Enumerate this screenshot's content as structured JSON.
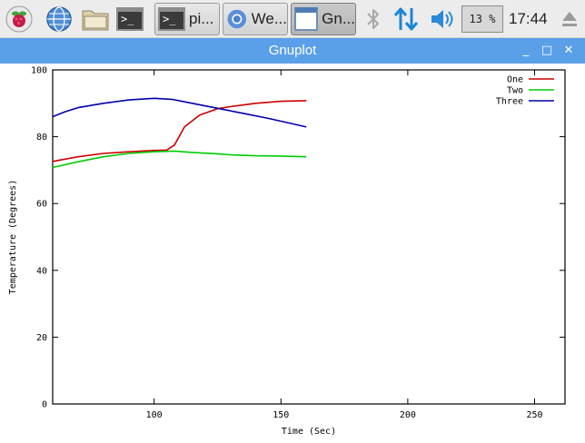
{
  "taskbar": {
    "launchers": [
      {
        "icon": "raspberry-menu-icon"
      },
      {
        "icon": "web-browser-icon"
      },
      {
        "icon": "file-manager-icon"
      },
      {
        "icon": "terminal-icon"
      }
    ],
    "tasks": [
      {
        "label": "pi...",
        "icon": "terminal-icon",
        "active": false
      },
      {
        "label": "We...",
        "icon": "chromium-icon",
        "active": false
      },
      {
        "label": "Gn...",
        "icon": "window-icon",
        "active": true
      }
    ],
    "tray": {
      "bluetooth_icon": "bluetooth-icon",
      "network_icon": "network-updown-icon",
      "volume_icon": "volume-icon",
      "cpu_usage": "13 %",
      "eject_icon": "eject-icon",
      "clock": "17:44"
    }
  },
  "window": {
    "title": "Gnuplot",
    "minimize": "_",
    "maximize": "□",
    "close": "✕"
  },
  "chart_data": {
    "type": "line",
    "title": "",
    "xlabel": "Time (Sec)",
    "ylabel": "Temperature (Degrees)",
    "xlim": [
      60,
      262
    ],
    "ylim": [
      0,
      100
    ],
    "xticks": [
      100,
      150,
      200,
      250
    ],
    "yticks": [
      0,
      20,
      40,
      60,
      80,
      100
    ],
    "grid": false,
    "legend": "top-right",
    "series": [
      {
        "name": "One",
        "color": "#cc0000",
        "x": [
          60,
          70,
          80,
          90,
          100,
          105,
          108,
          112,
          118,
          125,
          130,
          140,
          150,
          160
        ],
        "y": [
          72.6,
          74,
          75,
          75.5,
          75.9,
          76,
          77.5,
          83,
          86.5,
          88.4,
          89,
          90,
          90.6,
          90.8
        ]
      },
      {
        "name": "Two",
        "color": "#00cc00",
        "x": [
          60,
          70,
          80,
          90,
          100,
          108,
          115,
          125,
          130,
          140,
          150,
          160
        ],
        "y": [
          70.8,
          72.5,
          74,
          75,
          75.5,
          75.7,
          75.3,
          74.9,
          74.6,
          74.3,
          74.2,
          74
        ]
      },
      {
        "name": "Three",
        "color": "#0000aa",
        "x": [
          60,
          65,
          70,
          80,
          90,
          100,
          107,
          115,
          125,
          135,
          145,
          155,
          160
        ],
        "y": [
          86,
          87.5,
          88.7,
          90,
          91,
          91.5,
          91.2,
          90,
          88.5,
          87,
          85.5,
          83.8,
          82.9
        ]
      }
    ]
  }
}
